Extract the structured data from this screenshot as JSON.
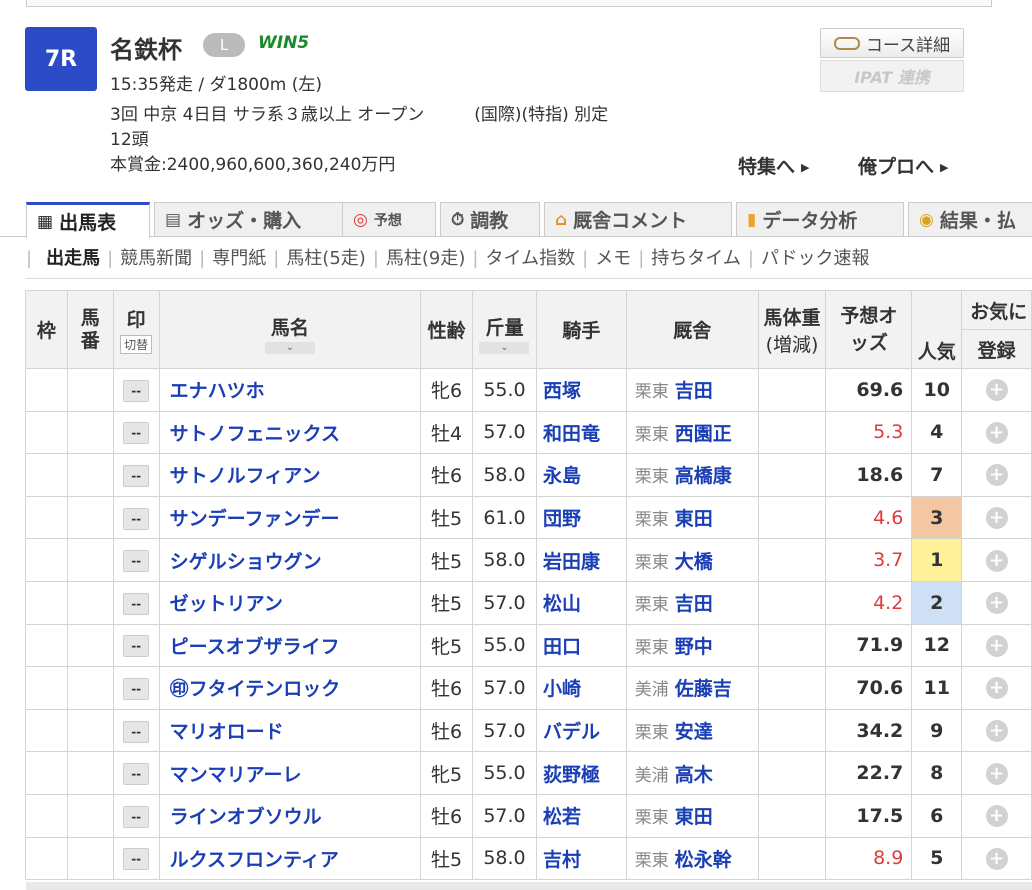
{
  "race": {
    "number": "7R",
    "name": "名鉄杯",
    "grade_badge": "L",
    "win5": "WIN5",
    "time_line": "15:35発走 / ダ1800m (左)",
    "meeting_line": "3回 中京 4日目 サラ系３歳以上 オープン",
    "conditions": "(国際)(特指) 別定",
    "runners": "12頭",
    "prize": "本賞金:2400,960,600,360,240万円"
  },
  "buttons": {
    "course_detail": "コース詳細",
    "ipat": "IPAT 連携",
    "feature": "特集へ",
    "my_pro": "俺プロへ"
  },
  "tabs": [
    {
      "label": "出馬表",
      "icon": "table-icon"
    },
    {
      "label": "オッズ・購入",
      "icon": "ipat-icon"
    },
    {
      "label": "予想",
      "icon": "target-icon"
    },
    {
      "label": "調教",
      "icon": "stopwatch-icon"
    },
    {
      "label": "厩舎コメント",
      "icon": "stable-icon"
    },
    {
      "label": "データ分析",
      "icon": "bar-chart-icon"
    },
    {
      "label": "結果・払",
      "icon": "coins-icon"
    }
  ],
  "subnav": [
    "出走馬",
    "競馬新聞",
    "専門紙",
    "馬柱(5走)",
    "馬柱(9走)",
    "タイム指数",
    "メモ",
    "持ちタイム",
    "パドック速報"
  ],
  "table": {
    "headers": {
      "waku": "枠",
      "umaban": "馬番",
      "mark": "印",
      "mark_switch": "切替",
      "horse": "馬名",
      "sexage": "性齢",
      "weight": "斤量",
      "jockey": "騎手",
      "stable": "厩舎",
      "body_weight": "馬体重",
      "body_weight_diff": "(増減)",
      "odds": "予想オッズ",
      "popularity": "人気",
      "favorite": "お気に",
      "register": "登録"
    },
    "mark_placeholder": "--",
    "rows": [
      {
        "horse": "エナハツホ",
        "sexage": "牝6",
        "weight": "55.0",
        "jockey": "西塚",
        "region": "栗東",
        "trainer": "吉田",
        "odds": "69.6",
        "pop": "10",
        "fav": false,
        "rank": 0
      },
      {
        "horse": "サトノフェニックス",
        "sexage": "牡4",
        "weight": "57.0",
        "jockey": "和田竜",
        "region": "栗東",
        "trainer": "西園正",
        "odds": "5.3",
        "pop": "4",
        "fav": true,
        "rank": 0
      },
      {
        "horse": "サトノルフィアン",
        "sexage": "牡6",
        "weight": "58.0",
        "jockey": "永島",
        "region": "栗東",
        "trainer": "高橋康",
        "odds": "18.6",
        "pop": "7",
        "fav": false,
        "rank": 0
      },
      {
        "horse": "サンデーファンデー",
        "sexage": "牡5",
        "weight": "61.0",
        "jockey": "団野",
        "region": "栗東",
        "trainer": "東田",
        "odds": "4.6",
        "pop": "3",
        "fav": true,
        "rank": 3
      },
      {
        "horse": "シゲルショウグン",
        "sexage": "牡5",
        "weight": "58.0",
        "jockey": "岩田康",
        "region": "栗東",
        "trainer": "大橋",
        "odds": "3.7",
        "pop": "1",
        "fav": true,
        "rank": 1
      },
      {
        "horse": "ゼットリアン",
        "sexage": "牡5",
        "weight": "57.0",
        "jockey": "松山",
        "region": "栗東",
        "trainer": "吉田",
        "odds": "4.2",
        "pop": "2",
        "fav": true,
        "rank": 2
      },
      {
        "horse": "ピースオブザライフ",
        "sexage": "牝5",
        "weight": "55.0",
        "jockey": "田口",
        "region": "栗東",
        "trainer": "野中",
        "odds": "71.9",
        "pop": "12",
        "fav": false,
        "rank": 0
      },
      {
        "horse": "㊞フタイテンロック",
        "sexage": "牡6",
        "weight": "57.0",
        "jockey": "小崎",
        "region": "美浦",
        "trainer": "佐藤吉",
        "odds": "70.6",
        "pop": "11",
        "fav": false,
        "rank": 0
      },
      {
        "horse": "マリオロード",
        "sexage": "牡6",
        "weight": "57.0",
        "jockey": "バデル",
        "region": "栗東",
        "trainer": "安達",
        "odds": "34.2",
        "pop": "9",
        "fav": false,
        "rank": 0
      },
      {
        "horse": "マンマリアーレ",
        "sexage": "牝5",
        "weight": "55.0",
        "jockey": "荻野極",
        "region": "美浦",
        "trainer": "高木",
        "odds": "22.7",
        "pop": "8",
        "fav": false,
        "rank": 0
      },
      {
        "horse": "ラインオブソウル",
        "sexage": "牡6",
        "weight": "57.0",
        "jockey": "松若",
        "region": "栗東",
        "trainer": "東田",
        "odds": "17.5",
        "pop": "6",
        "fav": false,
        "rank": 0
      },
      {
        "horse": "ルクスフロンティア",
        "sexage": "牡5",
        "weight": "58.0",
        "jockey": "吉村",
        "region": "栗東",
        "trainer": "松永幹",
        "odds": "8.9",
        "pop": "5",
        "fav": true,
        "rank": 0
      }
    ]
  },
  "colors": {
    "race_badge": "#2c4bc6",
    "link": "#1a3fb5",
    "odds_fav": "#e03a3a",
    "pop1": "#fdf29a",
    "pop2": "#cfe0f6",
    "pop3": "#f2c7a2"
  }
}
